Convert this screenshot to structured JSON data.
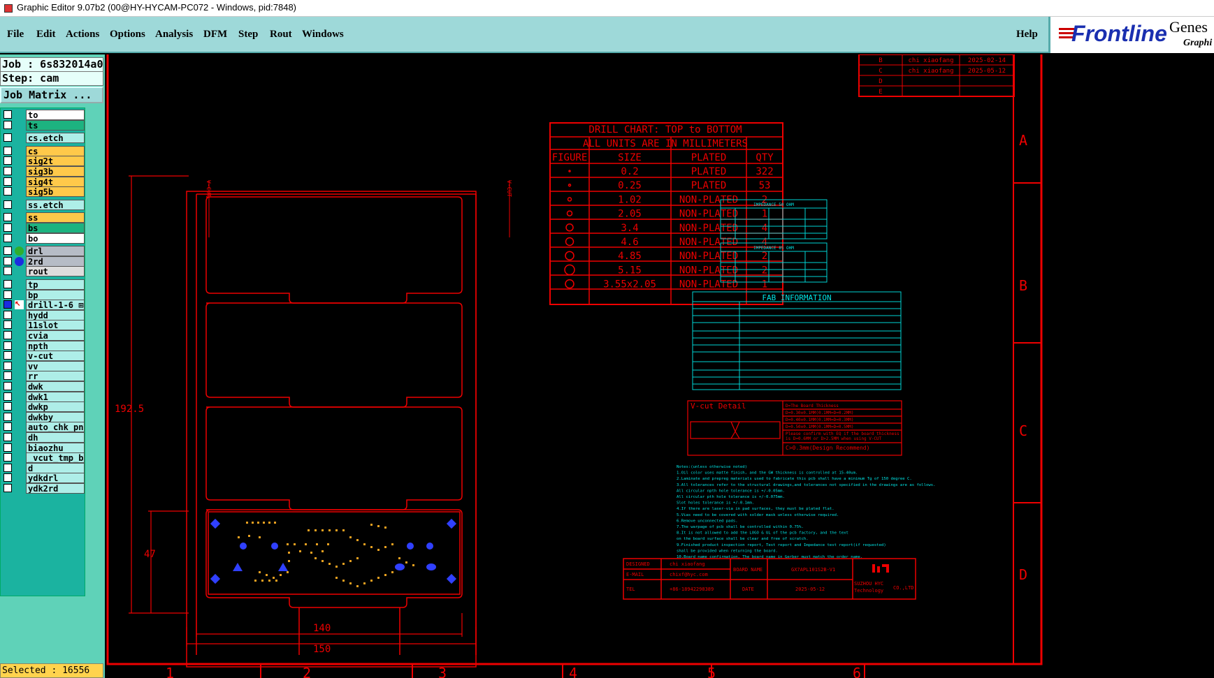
{
  "window": {
    "title": "Graphic Editor 9.07b2 (00@HY-HYCAM-PC072 - Windows, pid:7848)"
  },
  "menu": {
    "items": [
      "File",
      "Edit",
      "Actions",
      "Options",
      "Analysis",
      "DFM",
      "Step",
      "Rout",
      "Windows"
    ],
    "help": "Help"
  },
  "logo": {
    "name": "Frontline",
    "product": "Genes",
    "sub": "Graphi"
  },
  "panel": {
    "job": "Job : 6s832014a0",
    "step": "Step: cam",
    "job_matrix": "Job Matrix ...",
    "selected": "Selected : 16556"
  },
  "layers": [
    {
      "name": "to",
      "color": "#ffffff"
    },
    {
      "name": "ts",
      "color": "#1db380"
    },
    {
      "name": "cs.etch",
      "color": "#aeeee8"
    },
    {
      "name": "cs",
      "color": "#ffc94a"
    },
    {
      "name": "sig2t",
      "color": "#ffc94a"
    },
    {
      "name": "sig3b",
      "color": "#ffc94a"
    },
    {
      "name": "sig4t",
      "color": "#ffc94a"
    },
    {
      "name": "sig5b",
      "color": "#ffc94a"
    },
    {
      "name": "ss.etch",
      "color": "#aeeee8"
    },
    {
      "name": "ss",
      "color": "#ffc94a"
    },
    {
      "name": "bs",
      "color": "#1db380"
    },
    {
      "name": "bo",
      "color": "#ffffff"
    },
    {
      "name": "drl",
      "color": "#b6bcc6",
      "dot": "#2eae2e"
    },
    {
      "name": "2rd",
      "color": "#b6bcc6",
      "dot": "#1b2ce0"
    },
    {
      "name": "rout",
      "color": "#dddddd"
    },
    {
      "name": "tp",
      "color": "#aeeee8"
    },
    {
      "name": "bp",
      "color": "#aeeee8"
    },
    {
      "name": "drill-1-6",
      "color": "#aeeee8",
      "checked": true,
      "extra": "⊞"
    },
    {
      "name": "hydd",
      "color": "#aeeee8"
    },
    {
      "name": "11slot",
      "color": "#aeeee8"
    },
    {
      "name": "cvia",
      "color": "#aeeee8"
    },
    {
      "name": "npth",
      "color": "#aeeee8"
    },
    {
      "name": "v-cut",
      "color": "#aeeee8"
    },
    {
      "name": "vv",
      "color": "#aeeee8"
    },
    {
      "name": "rr",
      "color": "#aeeee8"
    },
    {
      "name": "dwk",
      "color": "#aeeee8"
    },
    {
      "name": "dwk1",
      "color": "#aeeee8"
    },
    {
      "name": "dwkp",
      "color": "#aeeee8"
    },
    {
      "name": "dwkby",
      "color": "#aeeee8"
    },
    {
      "name": "auto_chk_pn",
      "color": "#aeeee8"
    },
    {
      "name": "dh",
      "color": "#aeeee8"
    },
    {
      "name": "biaozhu",
      "color": "#aeeee8"
    },
    {
      "name": "_vcut_tmp_ba",
      "color": "#aeeee8"
    },
    {
      "name": "d",
      "color": "#aeeee8"
    },
    {
      "name": "ydkdrl",
      "color": "#aeeee8"
    },
    {
      "name": "ydk2rd",
      "color": "#aeeee8"
    }
  ],
  "drawing": {
    "drill_title1": "DRILL CHART: TOP to BOTTOM",
    "drill_title2": "ALL UNITS ARE IN MILLIMETERS",
    "drill_headers": [
      "FIGURE",
      "SIZE",
      "PLATED",
      "QTY"
    ],
    "drill_rows": [
      [
        "0.2",
        "PLATED",
        "322"
      ],
      [
        "0.25",
        "PLATED",
        "53"
      ],
      [
        "1.02",
        "NON-PLATED",
        "2"
      ],
      [
        "2.05",
        "NON-PLATED",
        "1"
      ],
      [
        "3.4",
        "NON-PLATED",
        "4"
      ],
      [
        "4.6",
        "NON-PLATED",
        "4"
      ],
      [
        "4.85",
        "NON-PLATED",
        "2"
      ],
      [
        "5.15",
        "NON-PLATED",
        "2"
      ],
      [
        "3.55x2.05",
        "NON-PLATED",
        "1"
      ]
    ],
    "dims": {
      "w140": "140",
      "w150": "150",
      "h192": "192.5",
      "h47": "47"
    },
    "rev": [
      [
        "B",
        "chi xiaofang",
        "2025-02-14"
      ],
      [
        "C",
        "chi xiaofang",
        "2025-05-12"
      ],
      [
        "D",
        "",
        ""
      ],
      [
        "E",
        "",
        ""
      ]
    ],
    "zones_right": [
      "A",
      "B",
      "C",
      "D"
    ],
    "zones_bottom": [
      "1",
      "2",
      "3",
      "4",
      "5",
      "6"
    ],
    "imp1_title": "IMPEDANCE 50 OHM",
    "imp2_title": "IMPEDANCE 85 OHM",
    "fab_title": "FAB INFORMATION",
    "vcut_title": "V-cut Detail",
    "vcut_lines": [
      "D=The Board Thickness",
      "D=0.30±0.1MM(0.1MM=D=0.2MM)",
      "D=0.40±0.1MM(0.1MM=D=0.3MM)",
      "D=0.50±0.1MM(0.1MM=D=0.5MM)",
      "Please confirm with EQ if the board thickness",
      "is D=0.6MM or D>2.5MM when using V-CUT",
      "C>0.3mm(Design Recommend)"
    ],
    "notes": [
      "Notes:(unless otherwise noted)",
      "1.Oil color uses matte finish, and the GW thickness is controlled at 15-40um.",
      "2.Laminate and prepreg materials used to fabricate this pcb shall have a minimum Tg of 150 degree C.",
      "3.All tolerances refer to the structural drawings,and tolerances not specified in the drawings are as follows.",
      "  All circular npth hole tolerance is +/-0.05mm.",
      "  All circular pth hole tolerance is +/-0.075mm.",
      "  Slot holes tolerance is +/-0.1mm.",
      "4.If there are laser-via in pad surfaces, they must be plated flat.",
      "5.Vias need to be covered with solder mask unless otherwise required.",
      "6.Remove unconnected pads.",
      "7.The warpage of pcb shall be controlled within 0.75%.",
      "8.It is not allowed to add the LOGO & UL of the pcb factory, and the text",
      "  on the board surface shall be clear and free of scratch.",
      "9.Finished product inspection report, Test report and Impedance test report(if requested)",
      "  shall be provided when returning the board.",
      "10.Board name confirmation, The board name in Gerber must match the order name."
    ],
    "title_block": {
      "designed": "DESIGNED",
      "designer": "chi xiaofang",
      "board_name_label": "BOARD NAME",
      "board_name": "GX7APL101S2B-V1",
      "email_label": "E-MAIL",
      "email": "chixf@hyc.com",
      "tel_label": "TEL",
      "tel": "+86-18942298389",
      "date_label": "DATE",
      "date": "2025-05-12",
      "company": "SUZHOU HYC",
      "company2": "Technology",
      "co": "CO.,LTD"
    }
  }
}
